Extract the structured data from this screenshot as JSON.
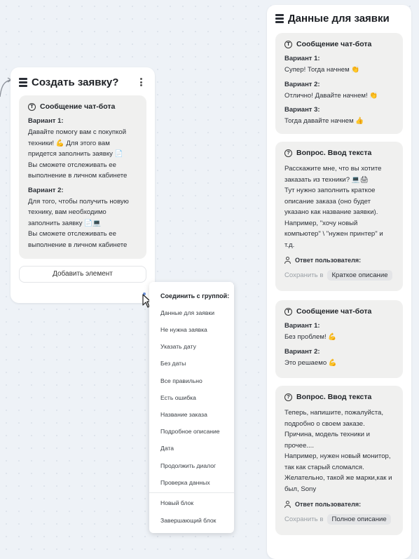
{
  "left_block": {
    "title": "Создать заявку?",
    "card": {
      "heading": "Сообщение чат-бота",
      "variants": [
        {
          "label": "Вариант 1:",
          "text": "Давайте помогу вам с покупкой\nтехники! 💪 Для этого вам\nпридется заполнить заявку 📄\nВы сможете отслеживать ее\nвыполнение в личном кабинете"
        },
        {
          "label": "Вариант 2:",
          "text": "Для того, чтобы получить новую\nтехнику, вам необходимо\nзаполнить заявку 📄💻\nВы сможете отслеживать ее\nвыполнение в личном кабинете"
        }
      ]
    },
    "add_button": "Добавить элемент"
  },
  "dropdown": {
    "heading": "Соединить с группой:",
    "items": [
      "Данные для заявки",
      "Не нужна заявка",
      "Указать дату",
      "Без даты",
      "Все правильно",
      "Есть ошибка",
      "Название заказа",
      "Подробное описание",
      "Дата",
      "Продолжить диалог",
      "Проверка данных"
    ],
    "extra_items": [
      "Новый блок",
      "Завершающий блок"
    ]
  },
  "right_panel": {
    "title": "Данные для заявки",
    "cards": [
      {
        "heading": "Сообщение чат-бота",
        "variants": [
          {
            "label": "Вариант 1:",
            "text": "Супер! Тогда начнем 👏"
          },
          {
            "label": "Вариант 2:",
            "text": "Отлично! Давайте начнем! 👏"
          },
          {
            "label": "Вариант 3:",
            "text": "Тогда давайте начнем 👍"
          }
        ]
      },
      {
        "heading": "Вопрос. Ввод текста",
        "text": "Расскажите мне, что вы хотите\nзаказать из техники? 💻🖨\nТут нужно заполнить краткое\nописание заказа (оно будет\nуказано как название заявки).\nНапример, \"хочу новый\nкомпьютер\" \\ \"нужен принтер\" и\nт.д.",
        "answer_label": "Ответ пользователя:",
        "save_label": "Сохранить в",
        "save_target": "Краткое описание"
      },
      {
        "heading": "Сообщение чат-бота",
        "variants": [
          {
            "label": "Вариант 1:",
            "text": "Без проблем! 💪"
          },
          {
            "label": "Вариант 2:",
            "text": "Это решаемо 💪"
          }
        ]
      },
      {
        "heading": "Вопрос. Ввод текста",
        "text": "Теперь, напишите, пожалуйста,\nподробно о своем заказе.\nПричина, модель техники и\nпрочее....\nНапример, нужен новый монитор,\nтак как старый сломался.\nЖелательно, такой же марки,как и\nбыл, Sony",
        "answer_label": "Ответ пользователя:",
        "save_label": "Сохранить в",
        "save_target": "Полное описание"
      }
    ]
  },
  "colors": {
    "canvas": "#eef2f7",
    "card": "#f0f0ef",
    "chip": "#e4e5e7",
    "accent_dot": "#6b8fd6"
  }
}
